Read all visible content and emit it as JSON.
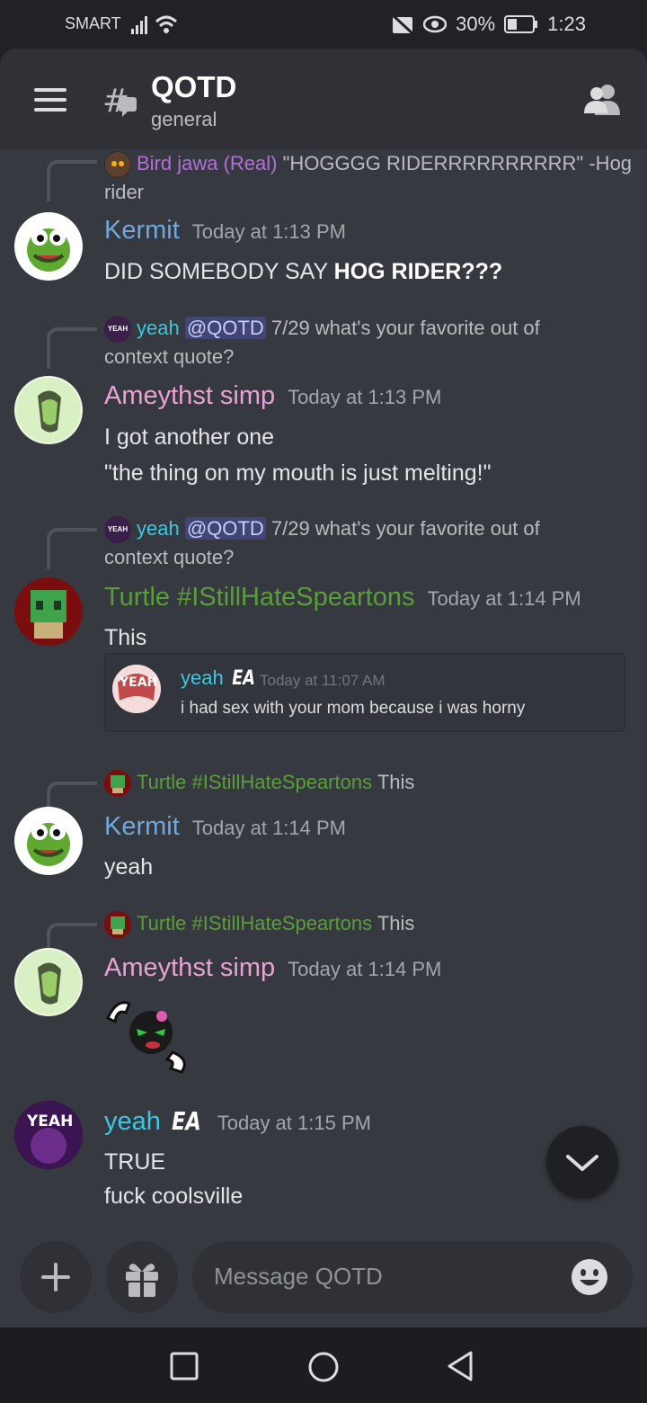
{
  "status_bar": {
    "carrier": "SMART",
    "battery": "30%",
    "time": "1:23"
  },
  "header": {
    "title": "QOTD",
    "subtitle": "general"
  },
  "messages": [
    {
      "reply": {
        "name": "Bird jawa (Real)",
        "text": "\"HOGGGG RIDERRRRRRRRRR\" -Hog",
        "text2": "rider"
      },
      "author": "Kermit",
      "timestamp": "Today at 1:13 PM",
      "text_pre": "DID SOMEBODY SAY ",
      "text_bold": "HOG RIDER???"
    },
    {
      "reply": {
        "name": "yeah",
        "mention": "@QOTD",
        "text": "7/29 what's your favorite out of",
        "text2": "context quote?"
      },
      "author": "Ameythst simp",
      "timestamp": "Today at 1:13 PM",
      "line1": "I got another one",
      "line2": "\"the thing on my mouth is just melting!\""
    },
    {
      "reply": {
        "name": "yeah",
        "mention": "@QOTD",
        "text": "7/29 what's your favorite out of",
        "text2": "context quote?"
      },
      "author": "Turtle #IStillHateSpeartons",
      "timestamp": "Today at 1:14 PM",
      "line1": "This",
      "embed": {
        "author": "yeah",
        "tag": "EA",
        "timestamp": "Today at 11:07 AM",
        "text": "i had sex with your mom because i was horny"
      }
    },
    {
      "reply": {
        "name": "Turtle #IStillHateSpeartons",
        "text": "This"
      },
      "author": "Kermit",
      "timestamp": "Today at 1:14 PM",
      "line1": "yeah"
    },
    {
      "reply": {
        "name": "Turtle #IStillHateSpeartons",
        "text": "This"
      },
      "author": "Ameythst simp",
      "timestamp": "Today at 1:14 PM"
    },
    {
      "author": "yeah",
      "tag": "EA",
      "timestamp": "Today at 1:15 PM",
      "line1": "TRUE",
      "line2": "fuck coolsville"
    }
  ],
  "avatar_labels": {
    "yeah": "YEAH"
  },
  "composer": {
    "placeholder": "Message QOTD"
  },
  "icons": [
    "hamburger-icon",
    "thread-icon",
    "members-icon",
    "chevron-down-icon",
    "plus-icon",
    "gift-icon",
    "emoji-icon",
    "nav-square-icon",
    "nav-circle-icon",
    "nav-back-icon"
  ],
  "colors": {
    "kermit": "#6fa8dc",
    "ameythst": "#e8a3d3",
    "turtle": "#5a9e3a",
    "yeah": "#3ec6e0",
    "bird": "#b070d8"
  }
}
